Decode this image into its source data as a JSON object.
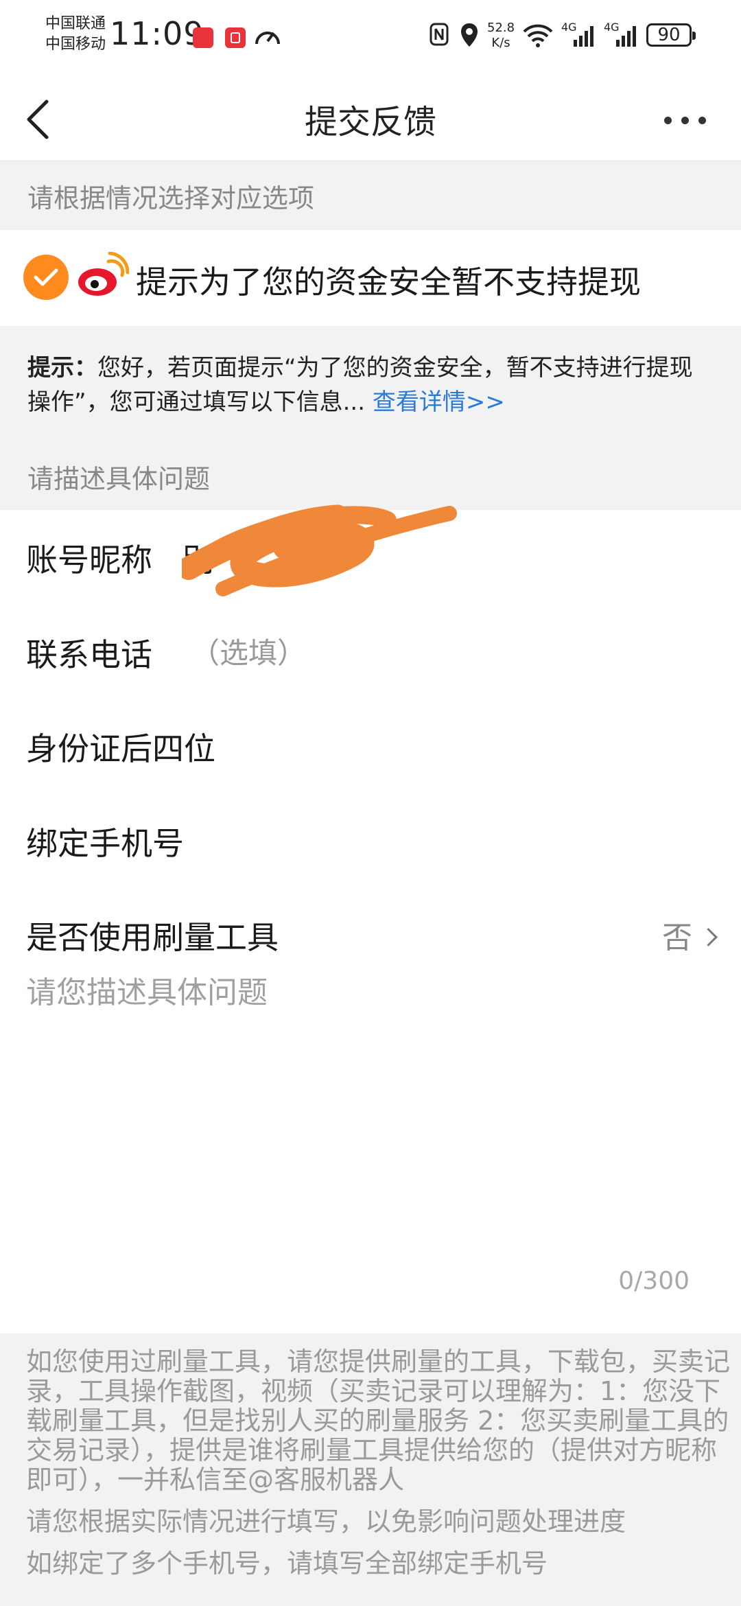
{
  "status_bar": {
    "carrier_1": "中国联通",
    "carrier_2": "中国移动",
    "time": "11:09",
    "speed_value": "52.8",
    "speed_unit": "K/s",
    "signal_1": "4G",
    "signal_2": "4G",
    "battery": "90"
  },
  "header": {
    "title": "提交反馈"
  },
  "section_choose": {
    "heading": "请根据情况选择对应选项",
    "option_label": "提示为了您的资金安全暂不支持提现"
  },
  "tip": {
    "prefix": "提示：",
    "text": "您好，若页面提示“为了您的资金安全，暂不支持进行提现操作”，您可通过填写以下信息...",
    "link": "查看详情>>"
  },
  "section_describe": {
    "heading": "请描述具体问题"
  },
  "form": {
    "nickname_label": "账号昵称",
    "nickname_value": "别",
    "phone_label": "联系电话",
    "phone_placeholder": "（选填）",
    "id_label": "身份证后四位",
    "bind_phone_label": "绑定手机号",
    "tool_label": "是否使用刷量工具",
    "tool_value": "否",
    "description_placeholder": "请您描述具体问题",
    "char_count": "0/300"
  },
  "notice": {
    "paragraph_1": "如您使用过刷量工具，请您提供刷量的工具，下载包，买卖记录，工具操作截图，视频（买卖记录可以理解为：1：您没下载刷量工具，但是找别人买的刷量服务 2：您买卖刷量工具的交易记录），提供是谁将刷量工具提供给您的（提供对方昵称即可），一并私信至@客服机器人",
    "paragraph_2": "请您根据实际情况进行填写，以免影响问题处理进度",
    "paragraph_3": "如绑定了多个手机号，请填写全部绑定手机号"
  },
  "colors": {
    "accent_orange": "#ff8a1e",
    "link_blue": "#2a7bd6",
    "section_gray": "#f2f2f2",
    "redaction": "#f0883a"
  },
  "icons": [
    "back-arrow-icon",
    "more-dots-icon",
    "check-icon",
    "weibo-logo-icon",
    "chevron-right-icon"
  ]
}
